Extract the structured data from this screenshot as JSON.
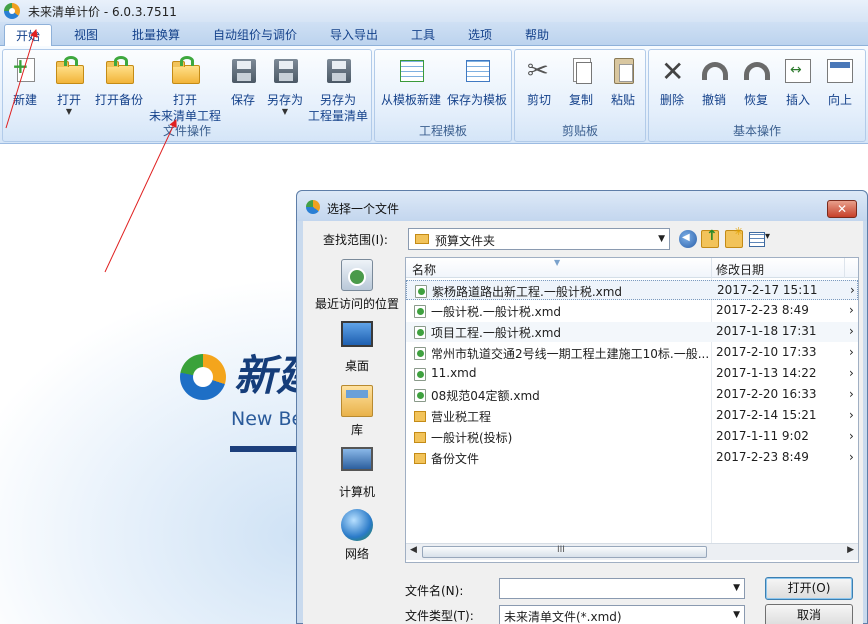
{
  "app": {
    "title": "未来清单计价 - 6.0.3.7511"
  },
  "tabs": [
    {
      "label": "开始",
      "active": true
    },
    {
      "label": "视图"
    },
    {
      "label": "批量换算"
    },
    {
      "label": "自动组价与调价"
    },
    {
      "label": "导入导出"
    },
    {
      "label": "工具"
    },
    {
      "label": "选项"
    },
    {
      "label": "帮助"
    }
  ],
  "ribbon": {
    "groups": [
      {
        "label": "文件操作"
      },
      {
        "label": "工程模板"
      },
      {
        "label": "剪贴板"
      },
      {
        "label": "基本操作"
      }
    ],
    "buttons": {
      "new": "新建",
      "open": "打开",
      "open_backup": "打开备份",
      "open_project_line1": "打开",
      "open_project_line2": "未来清单工程",
      "save": "保存",
      "save_as": "另存为",
      "save_as_quantity_line1": "另存为",
      "save_as_quantity_line2": "工程量清单",
      "new_from_template": "从模板新建",
      "save_as_template": "保存为模板",
      "cut": "剪切",
      "copy": "复制",
      "paste": "粘贴",
      "delete": "删除",
      "undo": "撤销",
      "redo": "恢复",
      "insert": "插入",
      "move_up": "向上"
    }
  },
  "splash": {
    "brand_cn": "新建",
    "brand_en": "New Be"
  },
  "dialog": {
    "title": "选择一个文件",
    "look_in_label": "查找范围(I):",
    "look_in_value": "预算文件夹",
    "places": [
      {
        "label": "最近访问的位置",
        "icon": "recent-places-icon"
      },
      {
        "label": "桌面",
        "icon": "desktop-icon"
      },
      {
        "label": "库",
        "icon": "library-icon"
      },
      {
        "label": "计算机",
        "icon": "computer-icon"
      },
      {
        "label": "网络",
        "icon": "network-icon"
      }
    ],
    "columns": {
      "name": "名称",
      "modified": "修改日期"
    },
    "files": [
      {
        "name": "紫杨路道路出新工程.一般计税.xmd",
        "date": "2017-2-17 15:11",
        "type": "xmd",
        "selected": true
      },
      {
        "name": "一般计税.一般计税.xmd",
        "date": "2017-2-23 8:49",
        "type": "xmd"
      },
      {
        "name": "项目工程.一般计税.xmd",
        "date": "2017-1-18 17:31",
        "type": "xmd"
      },
      {
        "name": "常州市轨道交通2号线一期工程土建施工10标.一般...",
        "date": "2017-2-10 17:33",
        "type": "xmd"
      },
      {
        "name": "11.xmd",
        "date": "2017-1-13 14:22",
        "type": "xmd"
      },
      {
        "name": "08规范04定额.xmd",
        "date": "2017-2-20 16:33",
        "type": "xmd"
      },
      {
        "name": "营业税工程",
        "date": "2017-2-14 15:21",
        "type": "folder"
      },
      {
        "name": "一般计税(投标)",
        "date": "2017-1-11 9:02",
        "type": "folder"
      },
      {
        "name": "备份文件",
        "date": "2017-2-23 8:49",
        "type": "folder"
      }
    ],
    "row_more": "›",
    "filename_label": "文件名(N):",
    "filename_value": "",
    "filetype_label": "文件类型(T):",
    "filetype_value": "未来清单文件(*.xmd)",
    "open_button": "打开(O)",
    "cancel_button": "取消",
    "close_glyph": "✕"
  },
  "colors": {
    "accent": "#15428b",
    "annotation": "#e02020"
  }
}
